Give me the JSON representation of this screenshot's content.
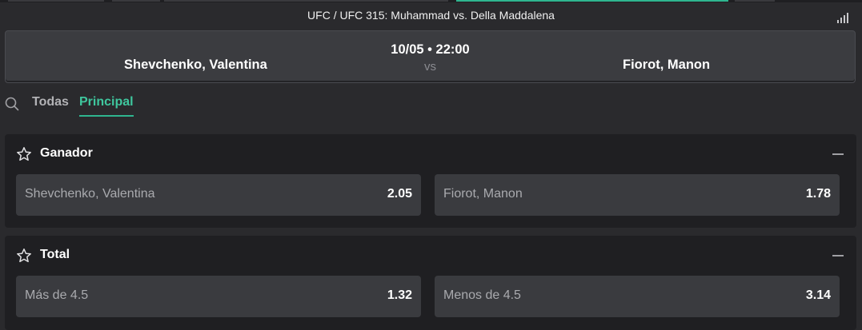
{
  "event": {
    "title": "UFC / UFC 315: Muhammad vs. Della Maddalena",
    "stats_icon": "bar-stats-icon"
  },
  "match": {
    "home": "Shevchenko, Valentina",
    "away": "Fiorot, Manon",
    "datetime": "10/05 • 22:00",
    "vs": "vs"
  },
  "tabs": [
    {
      "label": "Todas",
      "active": false
    },
    {
      "label": "Principal",
      "active": true
    }
  ],
  "markets": [
    {
      "title": "Ganador",
      "selections": [
        {
          "name": "Shevchenko, Valentina",
          "odds": "2.05"
        },
        {
          "name": "Fiorot, Manon",
          "odds": "1.78"
        }
      ]
    },
    {
      "title": "Total",
      "selections": [
        {
          "name": "Más de 4.5",
          "odds": "1.32"
        },
        {
          "name": "Menos de 4.5",
          "odds": "3.14"
        }
      ]
    }
  ],
  "colors": {
    "accent": "#2fb58f",
    "background": "#2a2a2d",
    "card": "#1f1f22",
    "odd_button": "#3a3b3f"
  }
}
